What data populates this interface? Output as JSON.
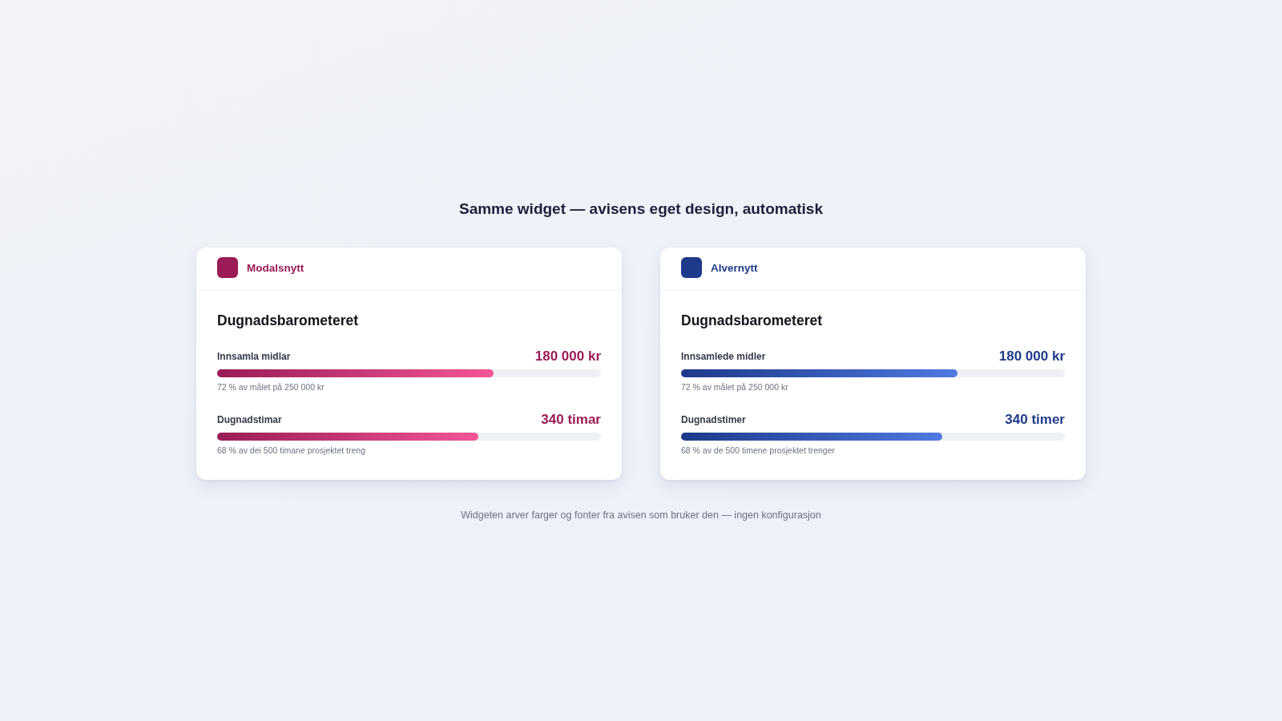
{
  "title": "Samme widget — avisens eget design, automatisk",
  "widgets": [
    {
      "publication": "Modalsnytt",
      "color": "#9a1b56",
      "heading": "Dugnadsbarometeret",
      "metrics": [
        {
          "label": "Innsamla midlar",
          "value": "180 000 kr",
          "level": 0.72,
          "caption": "72 % av målet på 250 000 kr"
        },
        {
          "label": "Dugnadstimar",
          "value": "340 timar",
          "level": 0.68,
          "caption": "68 % av dei 500 timane prosjektet treng"
        }
      ]
    },
    {
      "publication": "Alvernytt",
      "color": "#1e3a8a",
      "heading": "Dugnadsbarometeret",
      "metrics": [
        {
          "label": "Innsamlede midler",
          "value": "180 000 kr",
          "level": 0.72,
          "caption": "72 % av målet på 250 000 kr"
        },
        {
          "label": "Dugnadstimer",
          "value": "340 timer",
          "level": 0.68,
          "caption": "68 % av de 500 timene prosjektet trenger"
        }
      ]
    }
  ],
  "footnote": "Widgeten arver farger og fonter fra avisen som bruker den — ingen konfigurasjon"
}
